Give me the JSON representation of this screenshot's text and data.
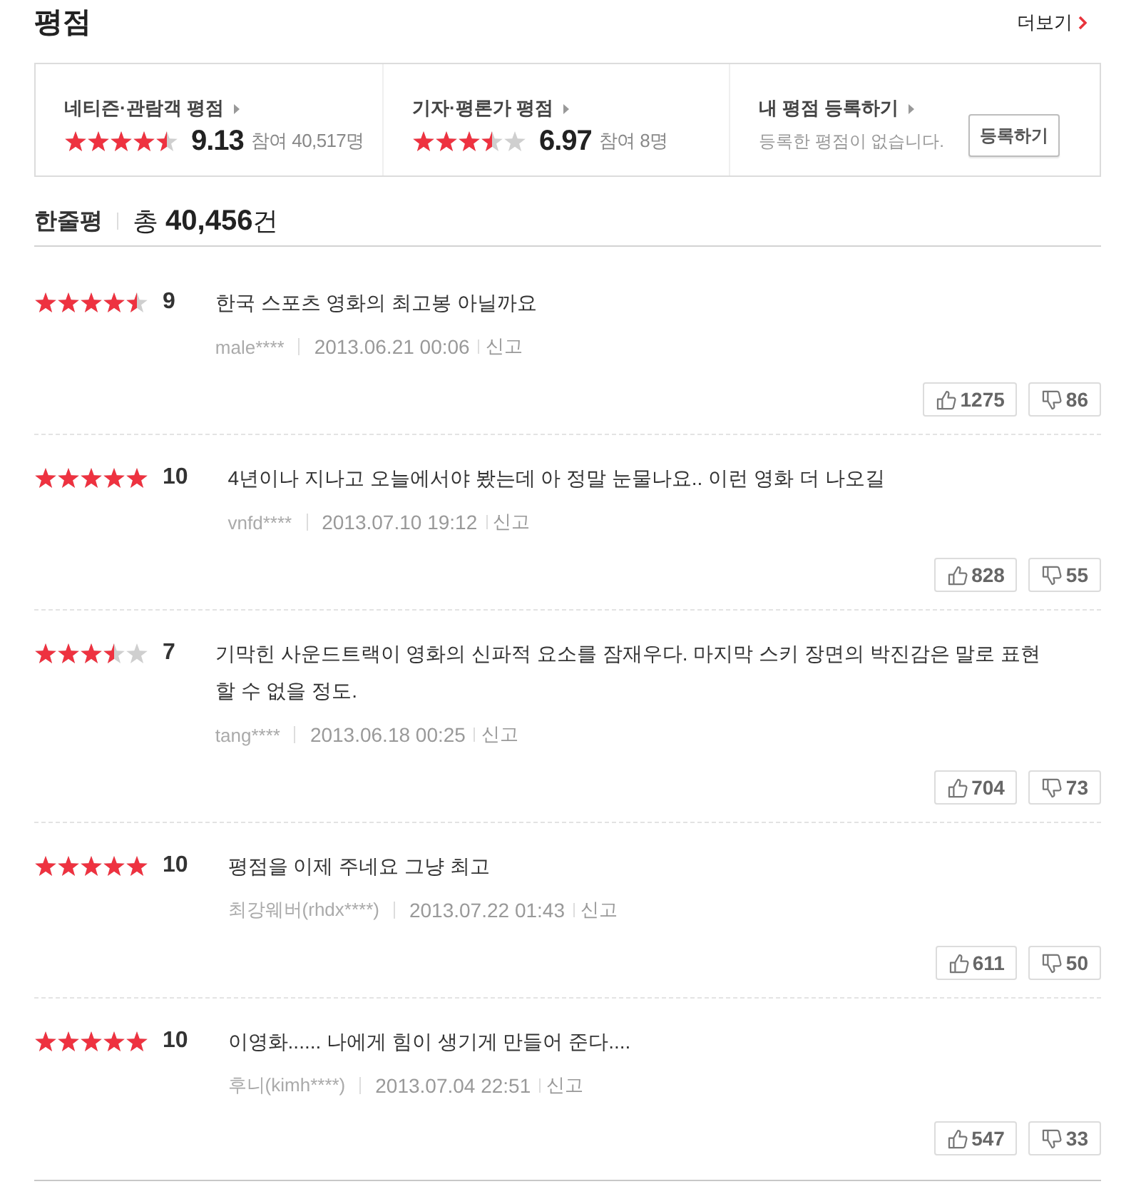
{
  "header": {
    "title": "평점",
    "more_link": "더보기"
  },
  "summary": {
    "panels": [
      {
        "kind": "rating",
        "label": "네티즌·관람객 평점",
        "stars": 4.5,
        "score": "9.13",
        "participants": "참여 40,517명"
      },
      {
        "kind": "rating",
        "label": "기자·평론가 평점",
        "stars": 3.5,
        "score": "6.97",
        "participants": "참여 8명"
      },
      {
        "kind": "register",
        "label": "내 평점 등록하기",
        "message": "등록한 평점이 없습니다.",
        "button": "등록하기"
      }
    ]
  },
  "comments": {
    "title": "한줄평",
    "total": "총 **40,456**건"
  },
  "reviews": [
    {
      "stars": 4.5,
      "score": "9",
      "text": "한국 스포츠 영화의 최고봉 아닐까요",
      "author": "male****",
      "date": "2013.06.21 00:06",
      "report": "신고",
      "likes": "1275",
      "dislikes": "86"
    },
    {
      "stars": 5,
      "score": "10",
      "text": "4년이나 지나고 오늘에서야 봤는데 아 정말 눈물나요.. 이런 영화 더 나오길",
      "author": "vnfd****",
      "date": "2013.07.10 19:12",
      "report": "신고",
      "likes": "828",
      "dislikes": "55"
    },
    {
      "stars": 3.5,
      "score": "7",
      "text": "기막힌 사운드트랙이 영화의 신파적 요소를 잠재우다. 마지막 스키 장면의 박진감은 말로 표현할 수 없을 정도.",
      "author": "tang****",
      "date": "2013.06.18 00:25",
      "report": "신고",
      "likes": "704",
      "dislikes": "73"
    },
    {
      "stars": 5,
      "score": "10",
      "text": "평점을 이제 주네요 그냥 최고",
      "author": "최강웨버(rhdx****)",
      "date": "2013.07.22 01:43",
      "report": "신고",
      "likes": "611",
      "dislikes": "50"
    },
    {
      "stars": 5,
      "score": "10",
      "text": "이영화...... 나에게 힘이 생기게 만들어 준다....",
      "author": "후니(kimh****)",
      "date": "2013.07.04 22:51",
      "report": "신고",
      "likes": "547",
      "dislikes": "33"
    }
  ]
}
